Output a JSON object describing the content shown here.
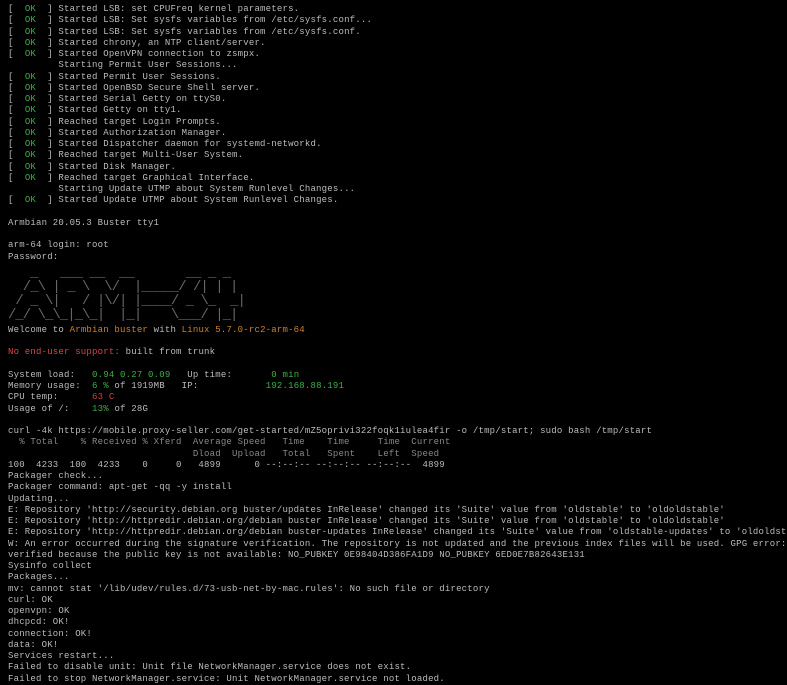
{
  "boot": [
    {
      "status": "OK",
      "verb": "Started",
      "label": "LSB: set CPUFreq kernel parameters."
    },
    {
      "status": "OK",
      "verb": "Started",
      "label": "LSB: Set sysfs variables from /etc/sysfs.conf..."
    },
    {
      "status": "OK",
      "verb": "Started",
      "label": "LSB: Set sysfs variables from /etc/sysfs.conf."
    },
    {
      "status": "OK",
      "verb": "Started",
      "label": "chrony, an NTP client/server."
    },
    {
      "status": "OK",
      "verb": "Started",
      "label": "OpenVPN connection to zsmpx."
    },
    {
      "status": "",
      "verb": "Starting",
      "label": "Permit User Sessions..."
    },
    {
      "status": "OK",
      "verb": "Started",
      "label": "Permit User Sessions."
    },
    {
      "status": "OK",
      "verb": "Started",
      "label": "OpenBSD Secure Shell server."
    },
    {
      "status": "OK",
      "verb": "Started",
      "label": "Serial Getty on ttyS0."
    },
    {
      "status": "OK",
      "verb": "Started",
      "label": "Getty on tty1."
    },
    {
      "status": "OK",
      "verb": "Reached target",
      "label": "Login Prompts."
    },
    {
      "status": "OK",
      "verb": "Started",
      "label": "Authorization Manager."
    },
    {
      "status": "OK",
      "verb": "Started",
      "label": "Dispatcher daemon for systemd-networkd."
    },
    {
      "status": "OK",
      "verb": "Reached target",
      "label": "Multi-User System."
    },
    {
      "status": "OK",
      "verb": "Started",
      "label": "Disk Manager."
    },
    {
      "status": "OK",
      "verb": "Reached target",
      "label": "Graphical Interface."
    },
    {
      "status": "",
      "verb": "Starting",
      "label": "Update UTMP about System Runlevel Changes..."
    },
    {
      "status": "OK",
      "verb": "Started",
      "label": "Update UTMP about System Runlevel Changes."
    }
  ],
  "banner": {
    "distro": "Armbian 20.05.3 Buster tty1",
    "login_prompt": "arm-64 login:",
    "login_user": "root",
    "password_prompt": "Password:",
    "ascii": "   _   ___ __  __       __ _ _\n  /_\\ | _ \\  \\/  |_____/ /| | |\n / _ \\|   / |\\/| |____/ _ \\_  _|\n/_/ \\_\\_|_\\_|  |_|    \\___/ |_|",
    "welcome_pre": "Welcome to ",
    "welcome_distro": "Armbian buster",
    "welcome_post": " with ",
    "welcome_kernel": "Linux 5.7.0-rc2-arm-64",
    "support_label": "No end-user support:",
    "support_val": " built from trunk"
  },
  "stats": {
    "sysload_label": "System load:",
    "sysload_val": "0.94 0.27 0.09",
    "uptime_label": "Up time:",
    "uptime_val": "0 min",
    "mem_label": "Memory usage:",
    "mem_val": "6 %",
    "mem_of": " of 1919MB",
    "ip_label": "IP:",
    "ip_val": "192.168.88.191",
    "cpu_label": "CPU temp:",
    "cpu_val": "63 C",
    "usage_label": "Usage of /:",
    "usage_val": "13%",
    "usage_of": " of 28G"
  },
  "curl": {
    "cmd": "curl -4k https://mobile.proxy-seller.com/get-started/mZ5oprivi322foqk1iulea4fir -o /tmp/start; sudo bash /tmp/start",
    "header1": "  % Total    % Received % Xferd  Average Speed   Time    Time     Time  Current",
    "header2": "                                 Dload  Upload   Total   Spent    Left  Speed",
    "row": "100  4233  100  4233    0     0   4899      0 --:--:-- --:--:-- --:--:--  4899"
  },
  "script": [
    "Packager check...",
    "Packager command: apt-get -qq -y install",
    "Updating...",
    "E: Repository 'http://security.debian.org buster/updates InRelease' changed its 'Suite' value from 'oldstable' to 'oldoldstable'",
    "E: Repository 'http://httpredir.debian.org/debian buster InRelease' changed its 'Suite' value from 'oldstable' to 'oldoldstable'",
    "E: Repository 'http://httpredir.debian.org/debian buster-updates InRelease' changed its 'Suite' value from 'oldstable-updates' to 'oldoldstable-updates'",
    "W: An error occurred during the signature verification. The repository is not updated and the previous index files will be used. GPG error: http://httpredir.debian.org/debian buster-backports InReleas",
    "verified because the public key is not available: NO_PUBKEY 0E98404D386FA1D9 NO_PUBKEY 6ED0E7B82643E131",
    "Sysinfo collect",
    "Packages...",
    "mv: cannot stat '/lib/udev/rules.d/73-usb-net-by-mac.rules': No such file or directory",
    "curl: OK",
    "openvpn: OK",
    "dhcpcd: OK!",
    "connection: OK!",
    "data: OK!",
    "Services restart...",
    "Failed to disable unit: Unit file NetworkManager.service does not exist.",
    "Failed to stop NetworkManager.service: Unit NetworkManager.service not loaded."
  ]
}
